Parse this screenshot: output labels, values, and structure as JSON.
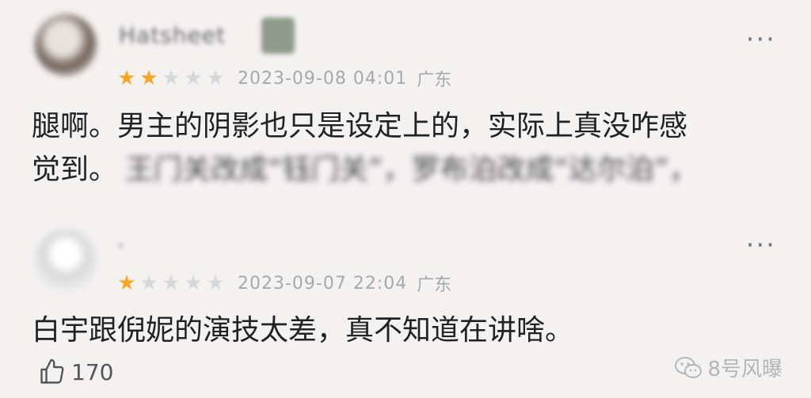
{
  "comments": [
    {
      "username": "Hatsheet",
      "rating": 2,
      "max_rating": 5,
      "date": "2023-09-08 04:01",
      "location": "广东",
      "text_line1": "腿啊。男主的阴影也只是设定上的，实际上真没咋感",
      "text_line2": "觉到。",
      "text_line2_blurred": "王门关改成“钰门关”，罗布泊改成“达尔泊”，"
    },
    {
      "username": "·",
      "rating": 1,
      "max_rating": 5,
      "date": "2023-09-07 22:04",
      "location": "广东",
      "text": "白宇跟倪妮的演技太差，真不知道在讲啥。"
    }
  ],
  "footer": {
    "like_count": "170",
    "like_icon": "thumbs-up-icon"
  },
  "watermark": {
    "text": "8号风曝",
    "icon": "wechat-icon"
  },
  "more_icon": "more-dots-icon",
  "colors": {
    "star_on": "#f5a623",
    "star_off": "#d7d7d7",
    "background": "#f4f1f1"
  }
}
